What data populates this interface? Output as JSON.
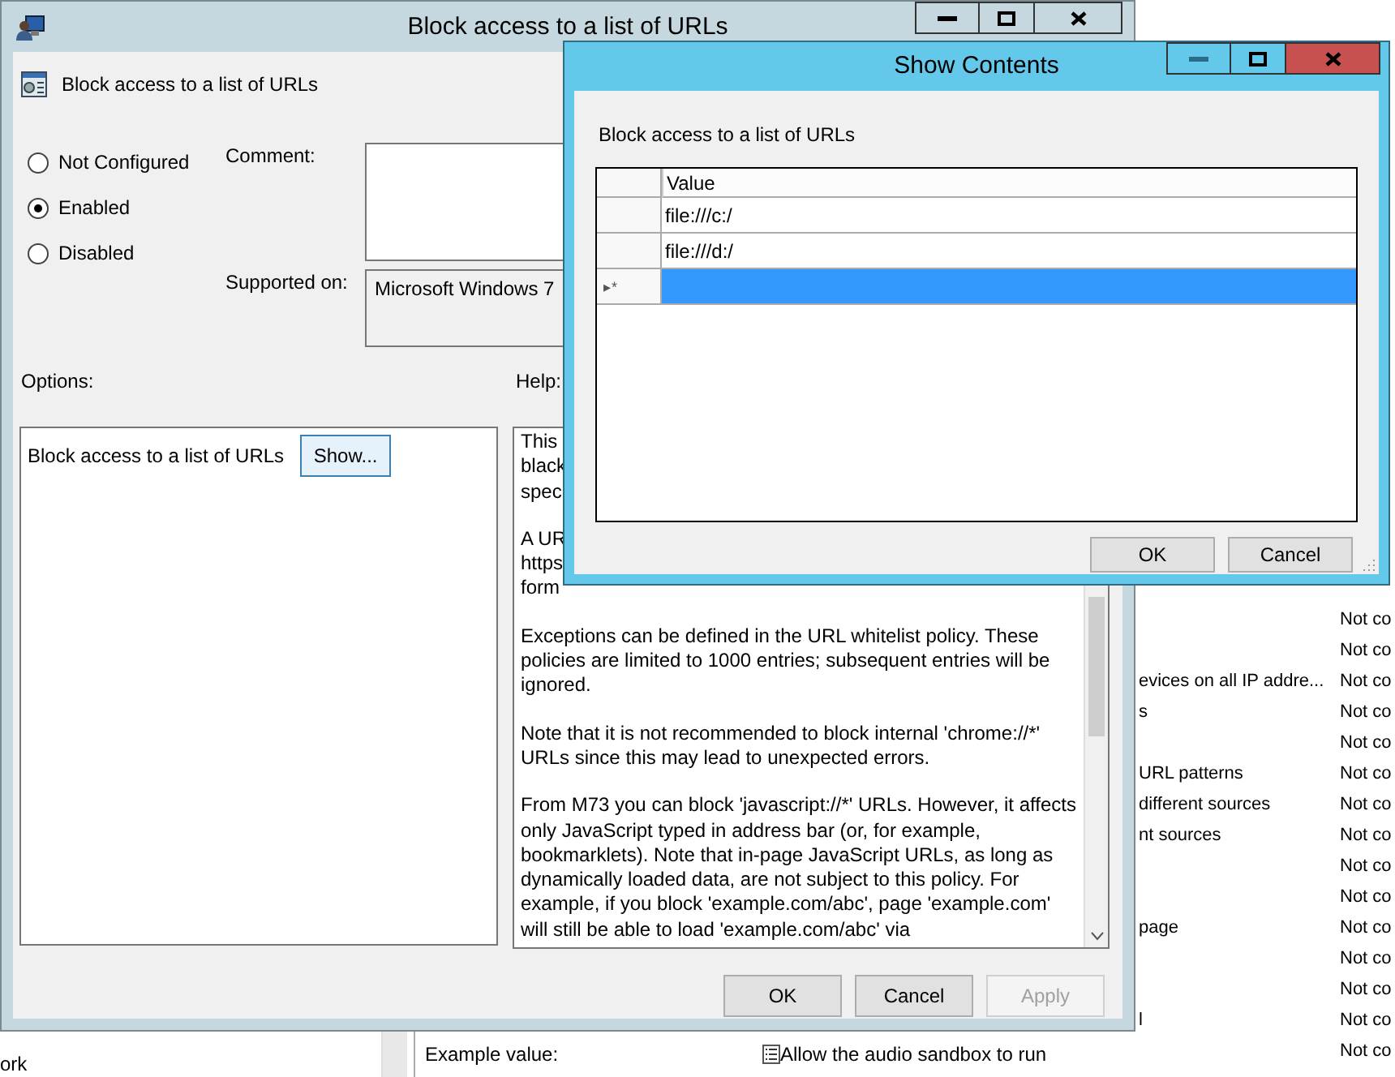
{
  "editor": {
    "settings_rows": [
      {
        "state": "Not co"
      },
      {
        "state": "Not co"
      },
      {
        "name": "evices on all IP addre...",
        "state": "Not co"
      },
      {
        "name": "s",
        "state": "Not co"
      },
      {
        "state": "Not co"
      },
      {
        "name": "URL patterns",
        "state": "Not co"
      },
      {
        "name": "different sources",
        "state": "Not co"
      },
      {
        "name": "nt sources",
        "state": "Not co"
      },
      {
        "state": "Not co"
      },
      {
        "state": "Not co"
      },
      {
        "name": "page",
        "state": "Not co"
      },
      {
        "state": "Not co"
      },
      {
        "state": "Not co"
      },
      {
        "name": "l",
        "state": "Not co"
      },
      {
        "state": "Not co"
      }
    ],
    "tree_text": "ork",
    "example_label": "Example value:",
    "policy_item": "Allow the audio sandbox to run"
  },
  "policy_dialog": {
    "title": "Block access to a list of URLs",
    "heading": "Block access to a list of URLs",
    "radios": [
      {
        "label": "Not Configured",
        "selected": false
      },
      {
        "label": "Enabled",
        "selected": true
      },
      {
        "label": "Disabled",
        "selected": false
      }
    ],
    "comment_label": "Comment:",
    "supported_label": "Supported on:",
    "supported_value": "Microsoft Windows 7",
    "options_label": "Options:",
    "help_label": "Help:",
    "option_item": {
      "label": "Block access to a list of URLs",
      "button": "Show..."
    },
    "help_paragraphs": [
      [
        "This",
        "black",
        "spec"
      ],
      [
        "A UR",
        "https",
        "form"
      ],
      [
        "Exceptions can be defined in the URL whitelist policy. These",
        "policies are limited to 1000 entries; subsequent entries will be",
        "ignored."
      ],
      [
        "Note that it is not recommended to block internal 'chrome://*'",
        "URLs since this may lead to unexpected errors."
      ],
      [
        "From M73 you can block 'javascript://*' URLs. However, it affects",
        "only JavaScript typed in address bar (or, for example,",
        "bookmarklets). Note that in-page JavaScript URLs, as long as",
        "dynamically loaded data, are not subject to this policy. For",
        "example, if you block 'example.com/abc', page 'example.com'",
        "will still be able to load 'example.com/abc' via"
      ]
    ],
    "buttons": [
      {
        "label": "OK",
        "disabled": false
      },
      {
        "label": "Cancel",
        "disabled": false
      },
      {
        "label": "Apply",
        "disabled": true
      }
    ]
  },
  "show_contents": {
    "title": "Show Contents",
    "heading": "Block access to a list of URLs",
    "column": "Value",
    "rows": [
      {
        "value": "file:///c:/",
        "selected": false
      },
      {
        "value": "file:///d:/",
        "selected": false
      },
      {
        "marker": "▸*",
        "selected": true
      }
    ],
    "buttons": [
      {
        "label": "OK"
      },
      {
        "label": "Cancel"
      }
    ]
  }
}
